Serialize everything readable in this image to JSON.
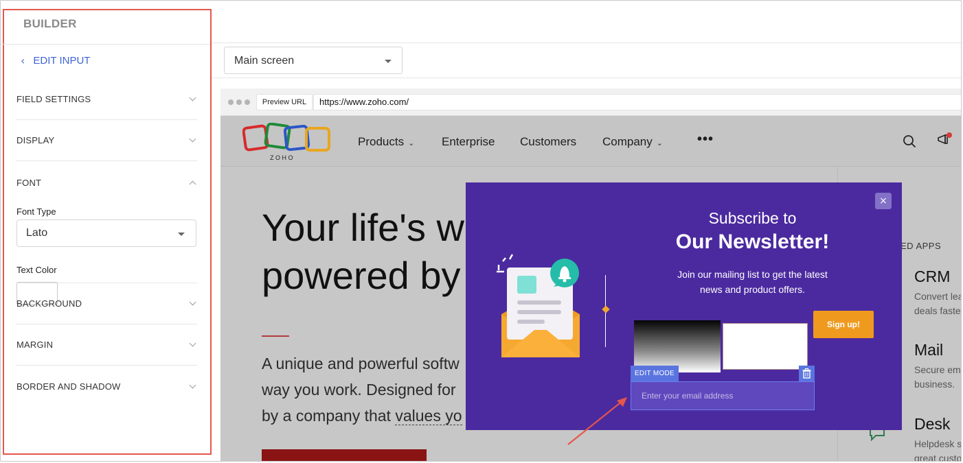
{
  "sidebar": {
    "title": "BUILDER",
    "back_label": "EDIT INPUT",
    "sections": {
      "field_settings": "FIELD SETTINGS",
      "display": "DISPLAY",
      "font": "FONT",
      "background": "BACKGROUND",
      "margin": "MARGIN",
      "border_shadow": "BORDER AND SHADOW"
    },
    "font_type_label": "Font Type",
    "font_type_value": "Lato",
    "text_color_label": "Text Color",
    "text_color_value": "#ffffff"
  },
  "main": {
    "screen_select_value": "Main screen"
  },
  "browser": {
    "preview_label": "Preview URL",
    "url": "https://www.zoho.com/"
  },
  "site": {
    "logo_text": "Z O H O",
    "nav": {
      "products": "Products",
      "enterprise": "Enterprise",
      "customers": "Customers",
      "company": "Company",
      "more": "•••"
    },
    "hero": {
      "title_line1": "Your life's wo",
      "title_line2": "powered by c",
      "text_line1": "A unique and powerful softw",
      "text_line2": "way you work. Designed for",
      "text_line3_pre": "by a company that ",
      "text_line3_ul": "values yo"
    },
    "related": {
      "title": "ED APPS",
      "apps": [
        {
          "name": "CRM",
          "desc1": "Convert lea",
          "desc2": "deals faste"
        },
        {
          "name": "Mail",
          "desc1": "Secure em",
          "desc2": "business."
        },
        {
          "name": "Desk",
          "desc1": "Helpdesk s",
          "desc2": "great custo"
        }
      ]
    }
  },
  "popup": {
    "close": "×",
    "heading1": "Subscribe to",
    "heading2": "Our Newsletter!",
    "desc_line1": "Join our mailing list to get the latest",
    "desc_line2": "news and product offers.",
    "signup_label": "Sign up!",
    "edit_mode_label": "EDIT MODE",
    "email_placeholder": "Enter your email address"
  },
  "colors": {
    "accent": "#3f64d4",
    "popup_bg": "#4b2a9f",
    "signup_bg": "#ef9a1f",
    "highlight_border": "#e5564b",
    "edit_tag": "#5a74df"
  }
}
